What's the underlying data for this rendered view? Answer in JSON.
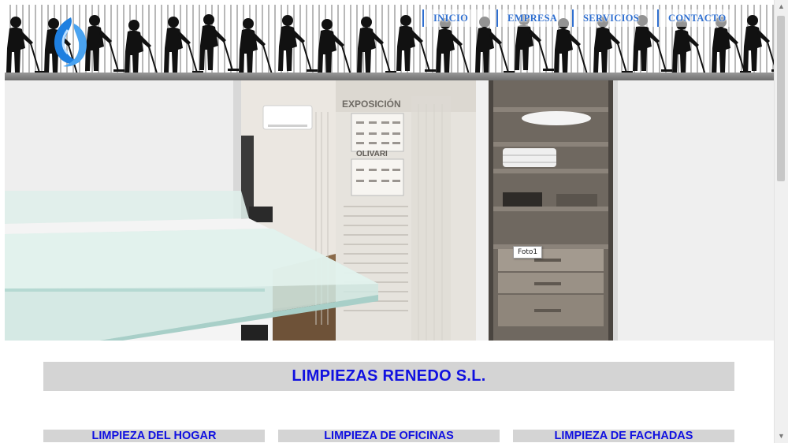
{
  "nav": {
    "items": [
      {
        "label": "INICIO"
      },
      {
        "label": "EMPRESA"
      },
      {
        "label": "SERVICIOS"
      },
      {
        "label": "CONTACTO"
      }
    ]
  },
  "hero": {
    "wall_label_1": "EXPOSICIÓN",
    "wall_label_2": "OLIVARI",
    "tooltip": "Foto1"
  },
  "main": {
    "title": "LIMPIEZAS RENEDO S.L.",
    "services": [
      {
        "label": "LIMPIEZA DEL HOGAR"
      },
      {
        "label": "LIMPIEZA DE OFICINAS"
      },
      {
        "label": "LIMPIEZA DE FACHADAS"
      }
    ]
  },
  "colors": {
    "nav_text": "#2f6fd0",
    "heading_text": "#1010e0",
    "box_background": "#d4d4d4",
    "logo_blue": "#1e7fe0"
  },
  "icons": {
    "logo": "water-drop-logo",
    "scroll_up": "scroll-up-arrow-icon",
    "scroll_down": "scroll-down-arrow-icon"
  }
}
